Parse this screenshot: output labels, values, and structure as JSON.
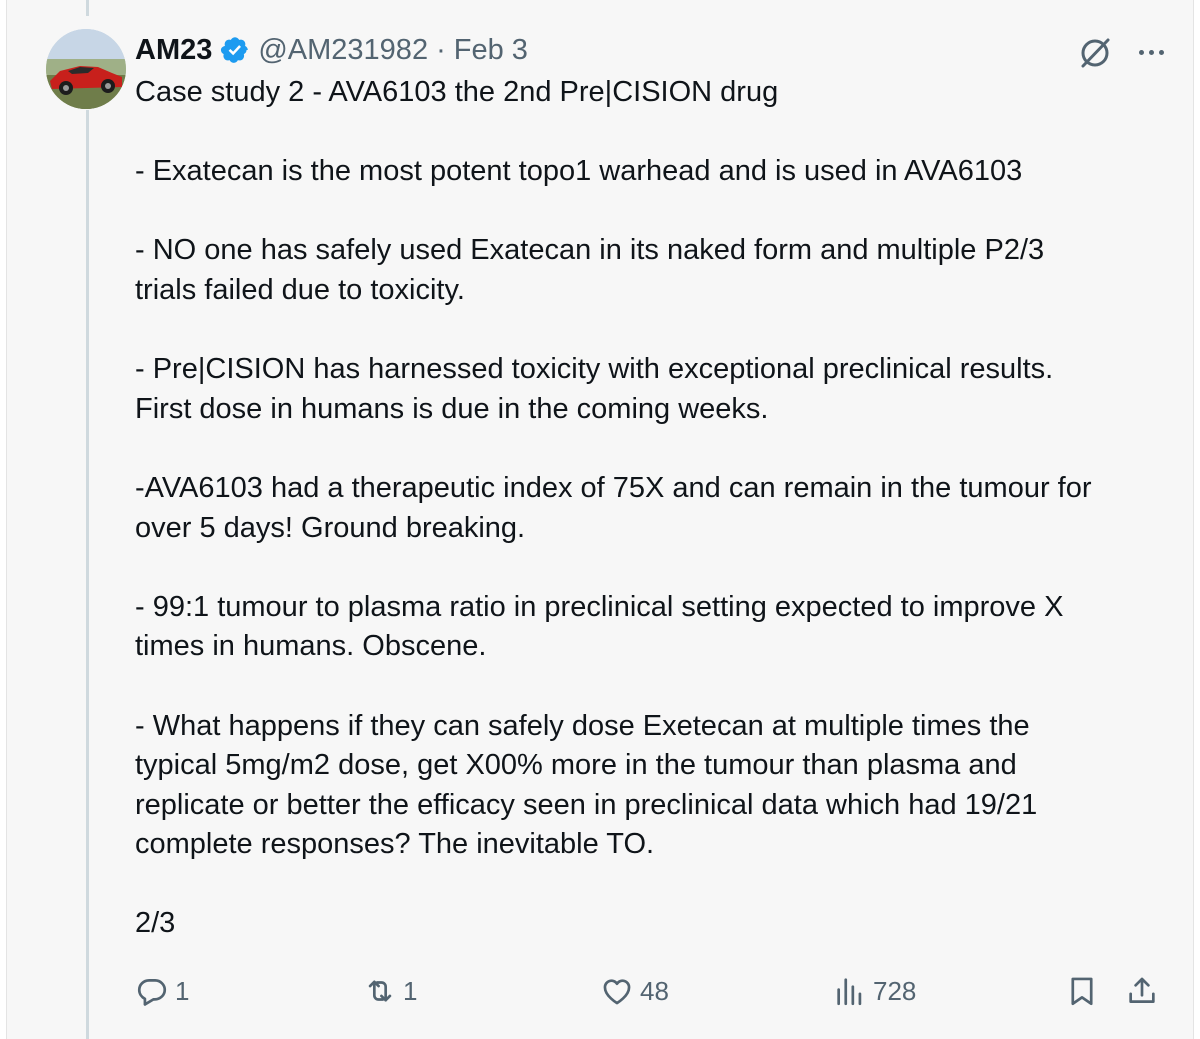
{
  "tweet": {
    "display_name": "AM23",
    "handle": "@AM231982",
    "separator": "·",
    "date": "Feb 3",
    "paragraphs": [
      "Case study 2 - AVA6103 the 2nd Pre|CISION drug",
      "- Exatecan is the most potent topo1 warhead and is used in AVA6103",
      "- NO one has safely used Exatecan in its naked form and multiple P2/3\ntrials failed due to toxicity.",
      "- Pre|CISION has harnessed toxicity with exceptional preclinical results.\nFirst dose in humans is due in the coming weeks.",
      "-AVA6103 had a therapeutic index of 75X and can remain in the tumour for\nover 5 days! Ground breaking.",
      "- 99:1 tumour to plasma ratio in preclinical setting expected to improve X\ntimes in humans. Obscene.",
      "- What happens if they can safely dose Exetecan at multiple times the\ntypical 5mg/m2 dose, get X00% more in the tumour than plasma and\nreplicate or better the efficacy seen in preclinical data which had 19/21\ncomplete responses? The inevitable TO.",
      "2/3"
    ]
  },
  "actions": {
    "replies": "1",
    "reposts": "1",
    "likes": "48",
    "views": "728"
  },
  "icons": {
    "verified": "verified-badge-icon",
    "grok": "grok-icon",
    "more": "more-icon",
    "reply": "reply-icon",
    "repost": "repost-icon",
    "like": "like-icon",
    "views": "views-icon",
    "bookmark": "bookmark-icon",
    "share": "share-icon"
  },
  "colors": {
    "text": "#0f1419",
    "secondary": "#536471",
    "verified": "#1d9bf0",
    "background": "#f7f7f7",
    "thread_line": "#cfd9de"
  }
}
